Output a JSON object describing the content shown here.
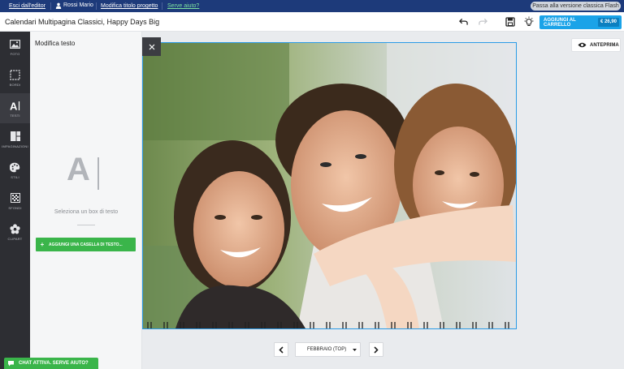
{
  "topbar": {
    "exit_editor": "Esci dall'editor",
    "user_name": "Rossi Mario",
    "edit_title": "Modifica titolo progetto",
    "help": "Serve aiuto?",
    "flash_version": "Passa alla versione classica Flash"
  },
  "titlebar": {
    "project_title": "Calendari Multipagina Classici, Happy Days Big",
    "add_to_cart": "AGGIUNGI AL CARRELLO",
    "price": "€ 26,90"
  },
  "rail": {
    "items": [
      {
        "label": "FOTO",
        "icon": "photo-icon"
      },
      {
        "label": "BORDI",
        "icon": "border-icon"
      },
      {
        "label": "TESTI",
        "icon": "text-icon"
      },
      {
        "label": "IMPAGINAZIONI",
        "icon": "layout-icon"
      },
      {
        "label": "STILI",
        "icon": "palette-icon"
      },
      {
        "label": "SFONDI",
        "icon": "background-icon"
      },
      {
        "label": "CLIPART",
        "icon": "clipart-icon"
      }
    ],
    "active_index": 2
  },
  "panel": {
    "title": "Modifica testo",
    "big_glyph": "A",
    "hint": "Seleziona un box di testo",
    "add_text_box": "AGGIUNGI UNA CASELLA DI TESTO..."
  },
  "canvas": {
    "preview": "ANTEPRIMA",
    "month": "FEBBRAIO (TOP)"
  },
  "chat": {
    "label": "CHAT ATTIVA. SERVE AIUTO?"
  },
  "colors": {
    "topbar": "#1d3a7a",
    "accent_blue": "#1aa3e8",
    "green": "#3ab54a",
    "rail": "#2d2e33"
  }
}
